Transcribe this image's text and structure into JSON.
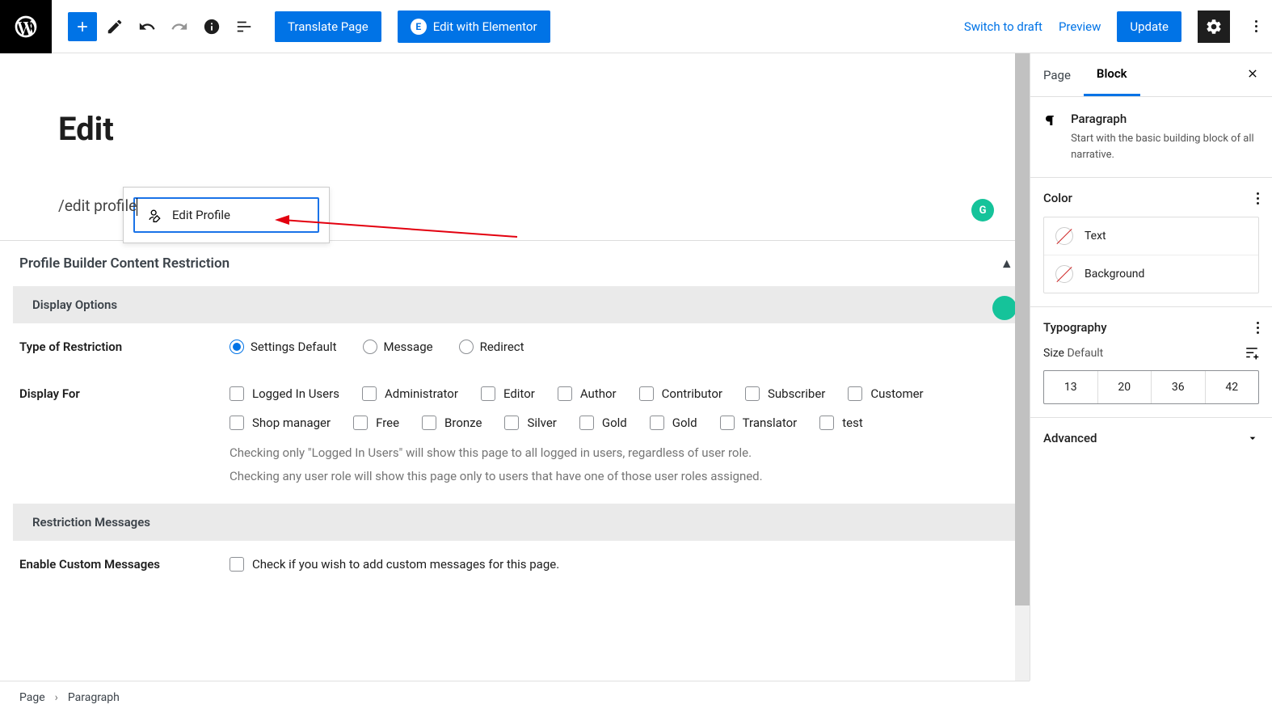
{
  "toolbar": {
    "translate": "Translate Page",
    "elementor": "Edit with Elementor",
    "switch_draft": "Switch to draft",
    "preview": "Preview",
    "update": "Update"
  },
  "editor": {
    "title": "Edit",
    "suggest_item": "Edit Profile",
    "block_text": "/edit profile",
    "grammarly": "G"
  },
  "meta": {
    "header": "Profile Builder Content Restriction",
    "display_options": "Display Options",
    "type_label": "Type of Restriction",
    "radios": [
      {
        "label": "Settings Default",
        "checked": true
      },
      {
        "label": "Message",
        "checked": false
      },
      {
        "label": "Redirect",
        "checked": false
      }
    ],
    "display_for_label": "Display For",
    "roles": [
      "Logged In Users",
      "Administrator",
      "Editor",
      "Author",
      "Contributor",
      "Subscriber",
      "Customer",
      "Shop manager",
      "Free",
      "Bronze",
      "Silver",
      "Gold",
      "Gold",
      "Translator",
      "test"
    ],
    "note1": "Checking only \"Logged In Users\" will show this page to all logged in users, regardless of user role.",
    "note2": "Checking any user role will show this page only to users that have one of those user roles assigned.",
    "restriction_messages": "Restriction Messages",
    "enable_custom_label": "Enable Custom Messages",
    "enable_custom_text": "Check if you wish to add custom messages for this page."
  },
  "sidebar": {
    "tab_page": "Page",
    "tab_block": "Block",
    "block": {
      "name": "Paragraph",
      "desc": "Start with the basic building block of all narrative."
    },
    "color": {
      "header": "Color",
      "text": "Text",
      "background": "Background"
    },
    "typography": {
      "header": "Typography",
      "size_label": "Size",
      "size_value": "Default",
      "sizes": [
        "13",
        "20",
        "36",
        "42"
      ]
    },
    "advanced": "Advanced"
  },
  "breadcrumb": {
    "page": "Page",
    "para": "Paragraph"
  }
}
